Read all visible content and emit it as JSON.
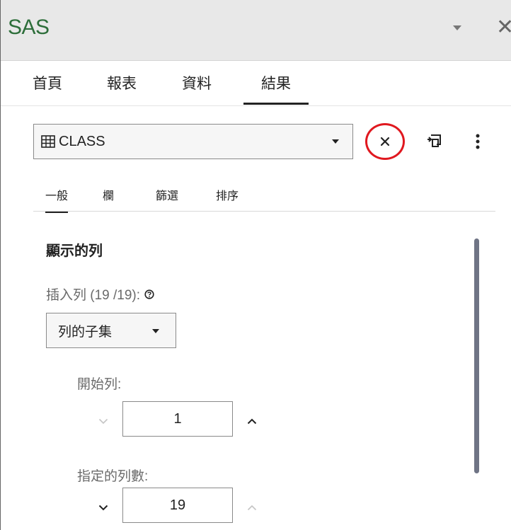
{
  "app": {
    "title": "SAS",
    "close_glyph": "✕"
  },
  "ribbon_tabs": [
    {
      "label": "首頁"
    },
    {
      "label": "報表"
    },
    {
      "label": "資料"
    },
    {
      "label": "結果",
      "active": true
    }
  ],
  "table_selector": {
    "value": "CLASS",
    "icon": "table-grid-icon"
  },
  "toolbar": {
    "clear_icon": "close-icon",
    "undock_icon": "undock-icon",
    "more_icon": "more-options-icon"
  },
  "sub_tabs": [
    {
      "label": "一般",
      "active": true
    },
    {
      "label": "欄"
    },
    {
      "label": "篩選"
    },
    {
      "label": "排序"
    }
  ],
  "panel": {
    "section_title": "顯示的列",
    "insert_rows_label": "插入列 (19 /19):",
    "subset_select": "列的子集",
    "start_row_label": "開始列:",
    "start_row_value": "1",
    "row_count_label": "指定的列數:",
    "row_count_value": "19"
  },
  "colors": {
    "accent_green": "#2d6e3a",
    "highlight_red": "#e0181f",
    "scrollbar": "#6f7485"
  }
}
